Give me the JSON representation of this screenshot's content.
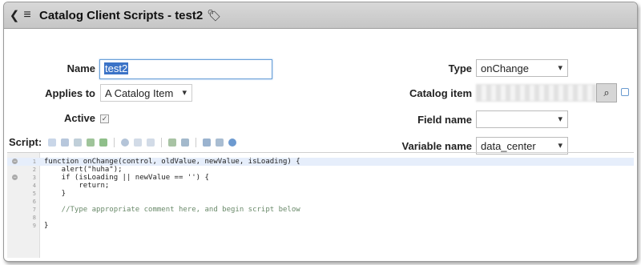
{
  "header": {
    "title": "Catalog Client Scripts - test2"
  },
  "form": {
    "name_label": "Name",
    "name_value": "test2",
    "applies_to_label": "Applies to",
    "applies_to_value": "A Catalog Item",
    "active_label": "Active",
    "active_checked": true,
    "type_label": "Type",
    "type_value": "onChange",
    "catalog_item_label": "Catalog item",
    "field_name_label": "Field name",
    "field_name_value": "",
    "variable_name_label": "Variable name",
    "variable_name_value": "data_center"
  },
  "script": {
    "label": "Script:",
    "lines": [
      {
        "n": "1",
        "code": "function onChange(control, oldValue, newValue, isLoading) {"
      },
      {
        "n": "2",
        "code": "    alert(\"huha\");"
      },
      {
        "n": "3",
        "code": "    if (isLoading || newValue == '') {"
      },
      {
        "n": "4",
        "code": "        return;"
      },
      {
        "n": "5",
        "code": "    }"
      },
      {
        "n": "6",
        "code": ""
      },
      {
        "n": "7",
        "code": "    //Type appropriate comment here, and begin script below"
      },
      {
        "n": "8",
        "code": ""
      },
      {
        "n": "9",
        "code": "}"
      }
    ]
  },
  "icons": [
    "back-icon",
    "menu-icon",
    "tag-icon",
    "search-icon",
    "reference-lookup-icon",
    "checkbox-check-icon"
  ],
  "colors": {
    "header_bg": "#cfcfcf",
    "selection": "#3b73c7",
    "keyword": "#1b1bbb",
    "comment": "#6a8a6a"
  }
}
